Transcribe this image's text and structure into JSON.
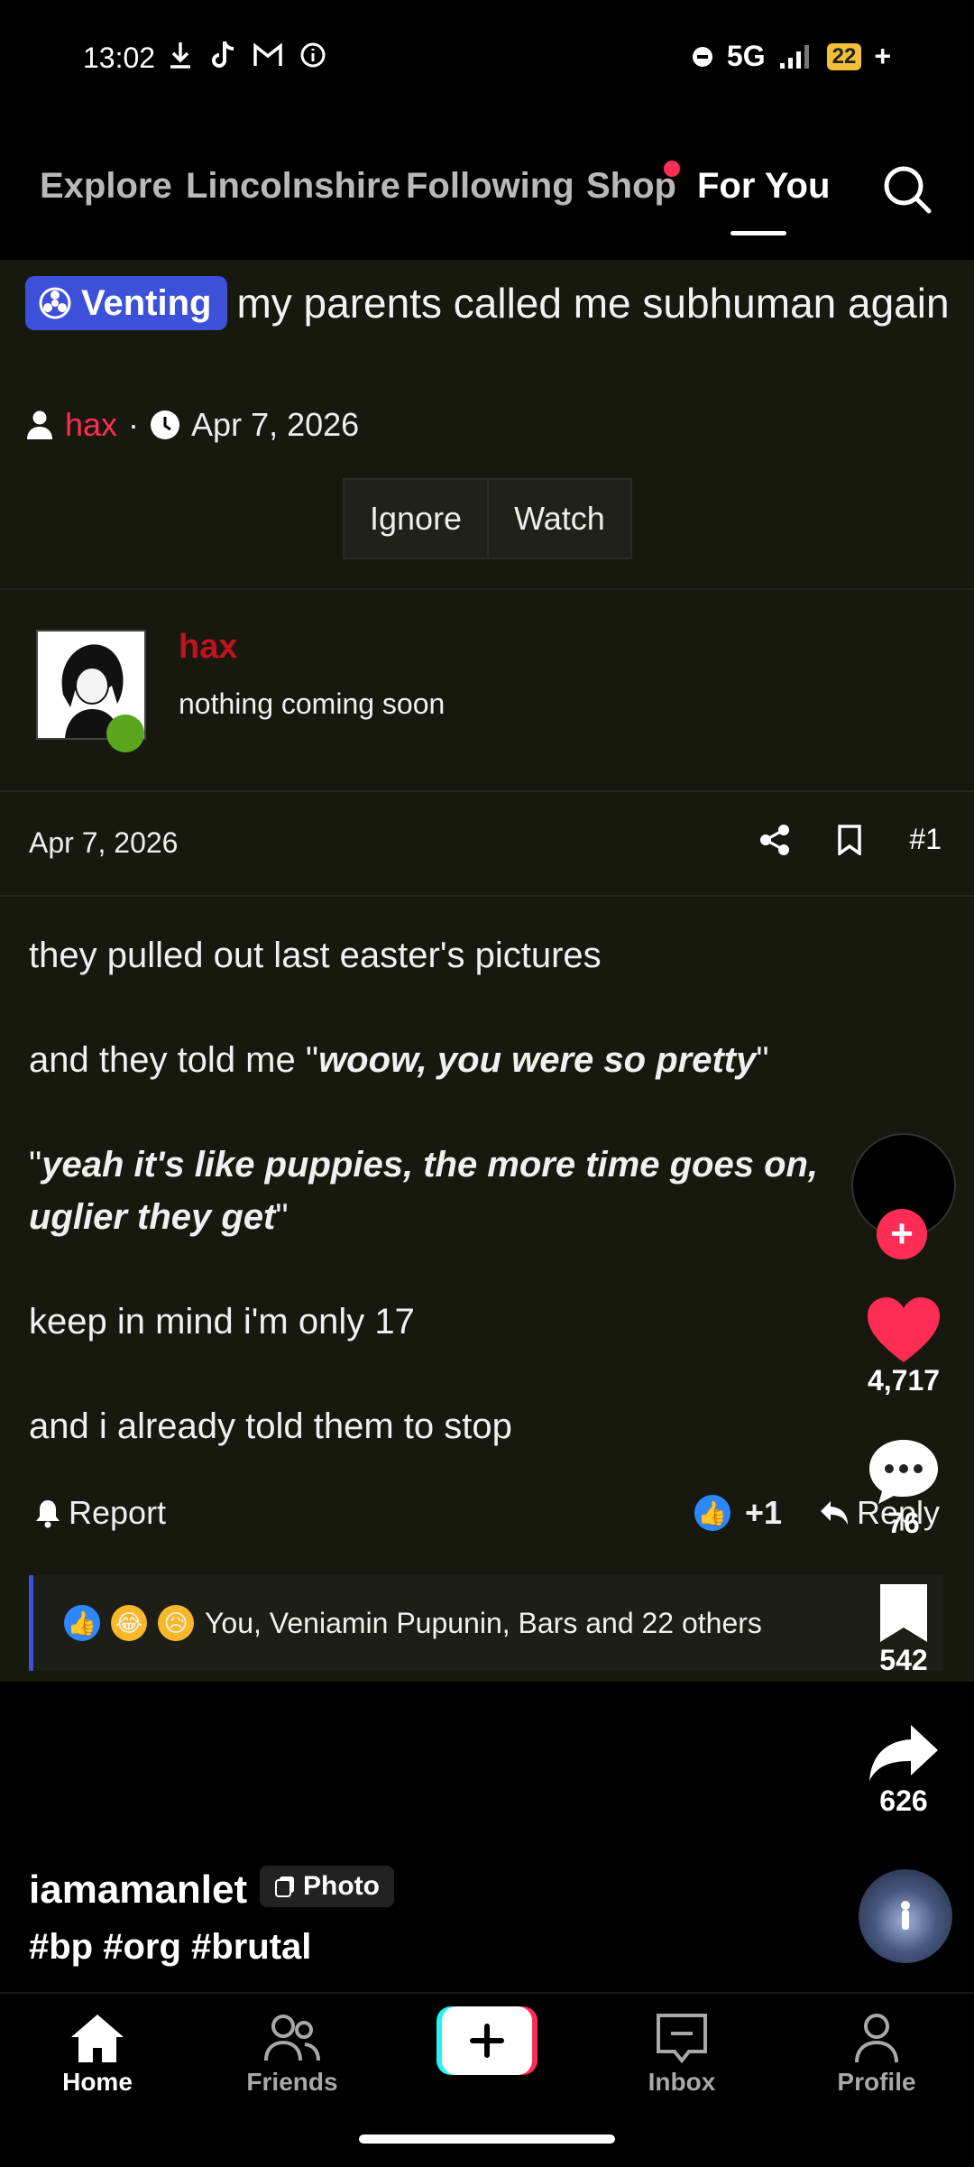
{
  "status_bar": {
    "time": "13:02",
    "network": "5G",
    "battery": "22"
  },
  "top_nav": {
    "tabs": [
      "Explore",
      "Lincolnshire",
      "Following",
      "Shop",
      "For You"
    ],
    "active_tab": "For You"
  },
  "post": {
    "tag": "Venting",
    "title": "my parents called me subhuman again",
    "author": "hax",
    "separator": "·",
    "date": "Apr 7, 2026",
    "buttons": {
      "ignore": "Ignore",
      "watch": "Watch"
    },
    "user": {
      "name": "hax",
      "bio": "nothing coming soon"
    },
    "post_date": "Apr 7, 2026",
    "post_number": "#1",
    "body": {
      "p1": "they pulled out last easter's pictures",
      "p2_pre": "and they told me \"",
      "p2_em": "woow, you were so pretty",
      "p2_post": "\"",
      "p3_pre": "\"",
      "p3_em": "yeah it's like puppies, the more time goes on, uglier they get",
      "p3_post": "\"",
      "p4": "keep in mind i'm only 17",
      "p5": "and i already told them to stop"
    },
    "report_label": "Report",
    "reaction_count": "+1",
    "reply_label": "Reply",
    "reactions_text": "You, Veniamin Pupunin, Bars and 22 others"
  },
  "actions": {
    "likes": "4,717",
    "comments": "76",
    "saves": "542",
    "shares": "626"
  },
  "creator": {
    "username": "iamamanlet",
    "media_type": "Photo",
    "hashtags": "#bp #org #brutal"
  },
  "bottom_nav": {
    "home": "Home",
    "friends": "Friends",
    "inbox": "Inbox",
    "profile": "Profile"
  },
  "colors": {
    "accent_red": "#ff2d55",
    "tag_blue": "#3d50d9",
    "panel_bg": "#17190f",
    "online_green": "#5aa51c"
  }
}
